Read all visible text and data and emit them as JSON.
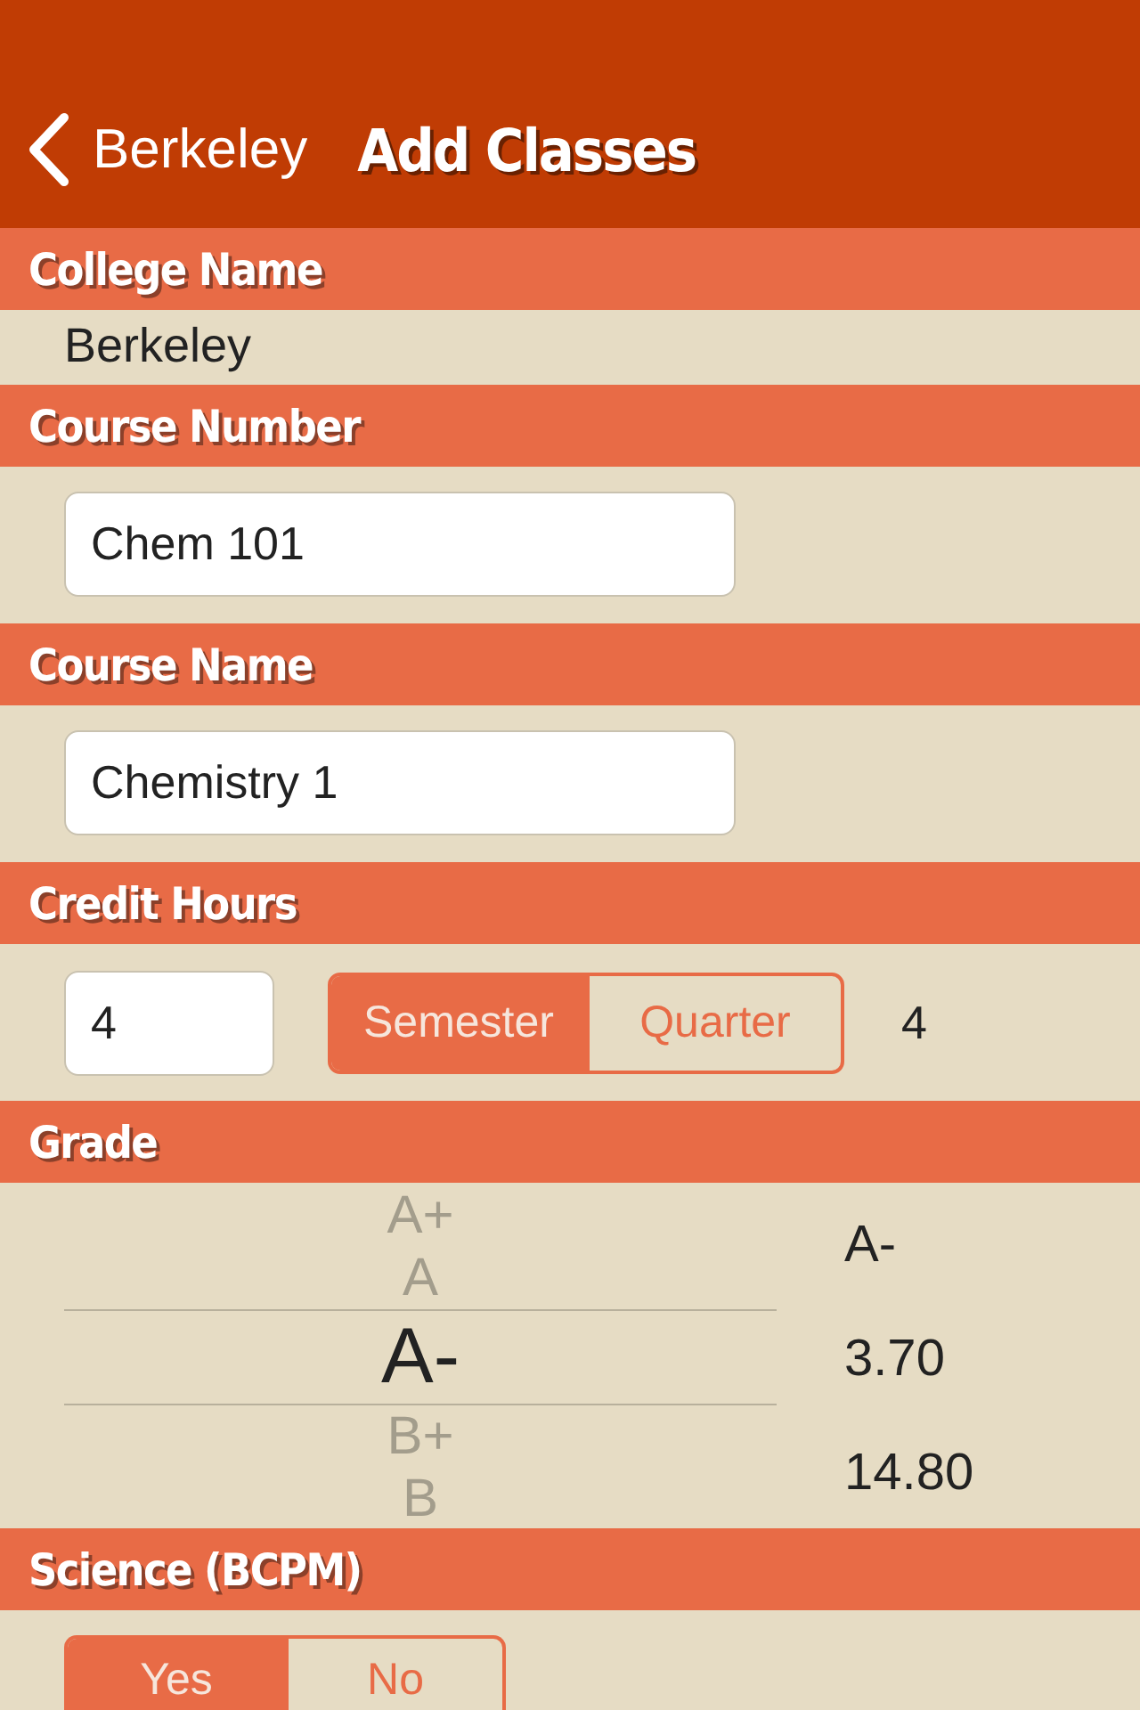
{
  "nav": {
    "back_label": "Berkeley",
    "title": "Add Classes"
  },
  "sections": [
    {
      "title": "College Name",
      "kind": "text",
      "value": "Berkeley"
    },
    {
      "title": "Course Number",
      "kind": "field",
      "value": "Chem 101"
    },
    {
      "title": "Course Name",
      "kind": "field",
      "value": "Chemistry 1"
    },
    {
      "title": "Credit Hours",
      "kind": "credits",
      "value": "4",
      "segments": [
        {
          "label": "Semester",
          "selected": true
        },
        {
          "label": "Quarter",
          "selected": false
        }
      ],
      "reading": "4"
    },
    {
      "title": "Grade",
      "kind": "picker",
      "options": [
        {
          "label": "A+",
          "selected": false
        },
        {
          "label": "A",
          "selected": false
        },
        {
          "label": "A-",
          "selected": true
        },
        {
          "label": "B+",
          "selected": false
        },
        {
          "label": "B",
          "selected": false
        }
      ],
      "results": [
        "A-",
        "3.70",
        "14.80"
      ]
    },
    {
      "title": "Science (BCPM)",
      "kind": "toggle",
      "segments": [
        {
          "label": "Yes",
          "selected": true
        },
        {
          "label": "No",
          "selected": false
        }
      ]
    }
  ]
}
